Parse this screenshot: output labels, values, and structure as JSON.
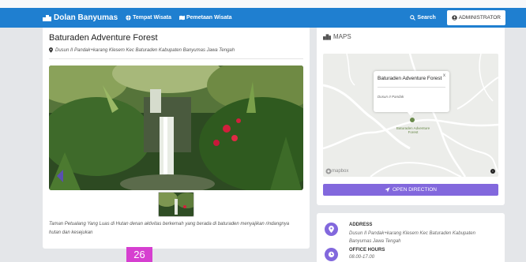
{
  "navbar": {
    "brand": "Dolan Banyumas",
    "links": [
      "Tempat Wisata",
      "Pemetaan Wisata"
    ],
    "search_label": "Search",
    "admin_label": "ADMINISTRATOR"
  },
  "place": {
    "title": "Baturaden Adventure Forest",
    "address": "Dusun II Pandak+karang Klesem Kec Baturaden Kabupaten Banyumas Jawa Tengah",
    "description": "Taman Petualang Yang Luas di Hutan denan aktivitas berkemah yang berada di baturaden menyajikan rindangnya hutan dan kesejukan"
  },
  "maps": {
    "heading": "MAPS",
    "popup_title": "Baturaden Adventure Forest",
    "popup_close": "x",
    "popup_addr": "Dusun II Pandak",
    "map_label": "Baturaden Adventure Forest",
    "attribution": "mapbox",
    "direction_label": "OPEN DIRECTION"
  },
  "info": {
    "address_label": "ADDRESS",
    "address_value": "Dusun II Pandak+karang Klesem Kec Baturaden Kabupaten Banyumas Jawa Tengah",
    "hours_label": "OFFICE HOURS",
    "hours_value": "08.00-17.00"
  },
  "page_badge": "26",
  "colors": {
    "navbar": "#1f7fd0",
    "accent": "#8268dd",
    "badge": "#d63fd0"
  },
  "icons": [
    "building-icon",
    "globe-icon",
    "map-icon",
    "search-icon",
    "user-circle-icon",
    "map-marker-icon",
    "location-arrow-icon",
    "clock-icon"
  ]
}
